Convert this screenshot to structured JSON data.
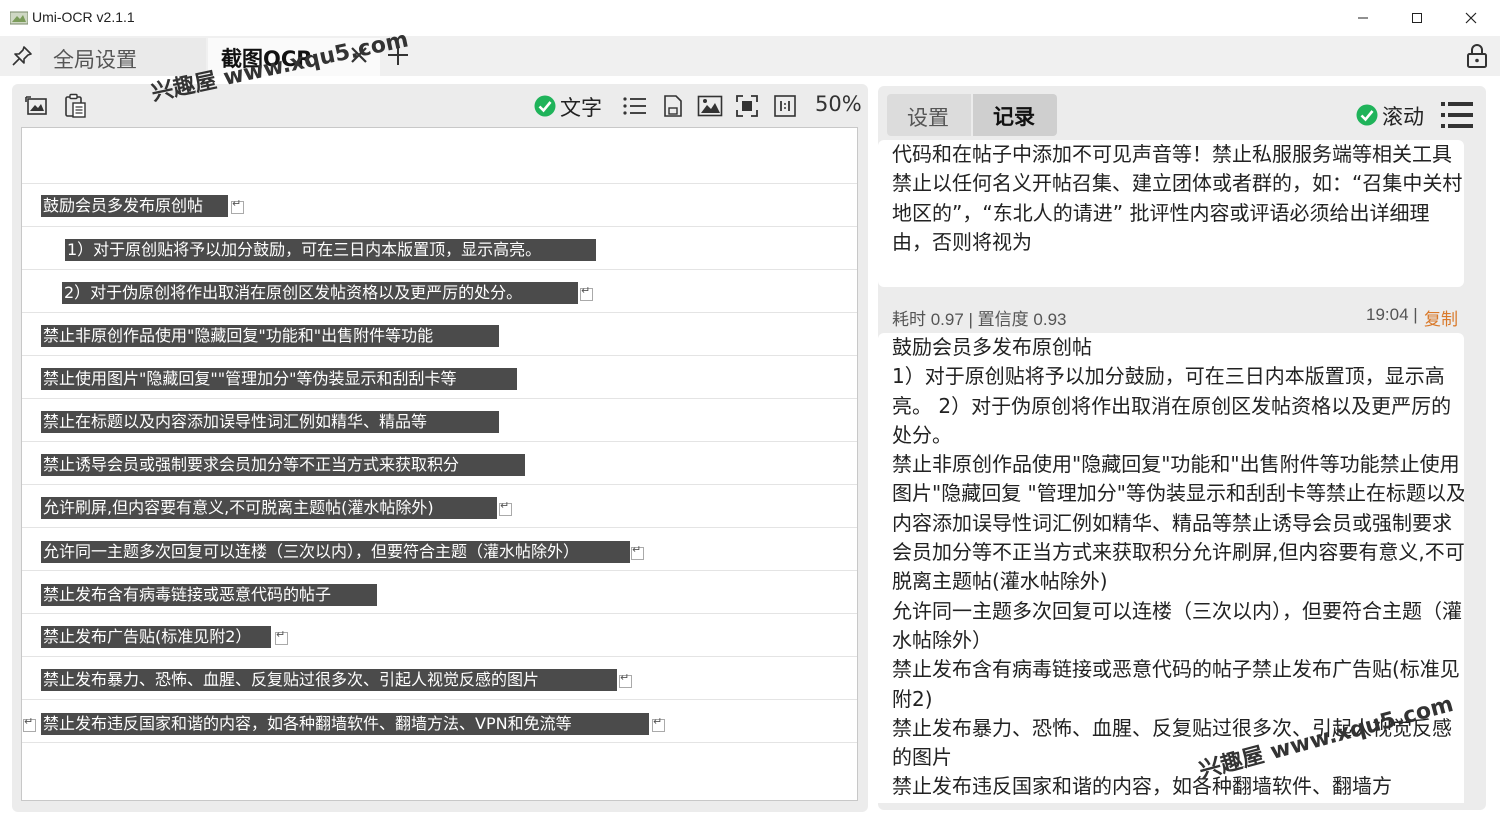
{
  "window": {
    "title": "Umi-OCR v2.1.1"
  },
  "tabs": {
    "global_settings": "全局设置",
    "screenshot_ocr": "截图OCR"
  },
  "left_toolbar": {
    "text_toggle_label": "文字",
    "zoom": "50%"
  },
  "ocr_lines": [
    "鼓励会员多发布原创帖",
    "1）对于原创贴将予以加分鼓励，可在三日内本版置顶，显示高亮。",
    "2）对于伪原创将作出取消在原创区发帖资格以及更严厉的处分。",
    "禁止非原创作品使用\"隐藏回复\"功能和\"出售附件等功能",
    "禁止使用图片\"隐藏回复\"\"管理加分\"等伪装显示和刮刮卡等",
    "禁止在标题以及内容添加误导性词汇例如精华、精品等",
    "禁止诱导会员或强制要求会员加分等不正当方式来获取积分",
    "允许刷屏,但内容要有意义,不可脱离主题帖(灌水帖除外)",
    "允许同一主题多次回复可以连楼（三次以内），但要符合主题（灌水帖除外）",
    "禁止发布含有病毒链接或恶意代码的帖子",
    "禁止发布广告贴(标准见附2）",
    "禁止发布暴力、恐怖、血腥、反复贴过很多次、引起人视觉反感的图片",
    "禁止发布违反国家和谐的内容，如各种翻墙软件、翻墙方法、VPN和免流等"
  ],
  "right_panel": {
    "tab_settings": "设置",
    "tab_record": "记录",
    "scroll_label": "滚动",
    "previous_record_text": "代码和在帖子中添加不可见声音等！禁止私服服务端等相关工具\n禁止以任何名义开帖召集、建立团体或者群的，如：“召集中关村地区的”，“东北人的请进” 批评性内容或评语必须给出详细理由，否则将视为",
    "record": {
      "meta": "耗时 0.97 | 置信度 0.93",
      "time": "19:04 |",
      "copy": "复制",
      "text": "鼓励会员多发布原创帖\n1）对于原创贴将予以加分鼓励，可在三日内本版置顶，显示高亮。 2）对于伪原创将作出取消在原创区发帖资格以及更严厉的处分。\n禁止非原创作品使用\"隐藏回复\"功能和\"出售附件等功能禁止使用图片\"隐藏回复 \"管理加分\"等伪装显示和刮刮卡等禁止在标题以及内容添加误导性词汇例如精华、精品等禁止诱导会员或强制要求会员加分等不正当方式来获取积分允许刷屏,但内容要有意义,不可脱离主题帖(灌水帖除外)\n允许同一主题多次回复可以连楼（三次以内），但要符合主题（灌水帖除外）\n禁止发布含有病毒链接或恶意代码的帖子禁止发布广告贴(标准见附2)\n禁止发布暴力、恐怖、血腥、反复贴过很多次、引起人视觉反感的图片\n禁止发布违反国家和谐的内容，如各种翻墙软件、翻墙方"
    }
  },
  "watermarks": {
    "top": "兴趣屋 www.xqu5.com",
    "bottom": "兴趣屋 www.xqu5.com"
  },
  "colors": {
    "check_green": "#1fb35a",
    "copy_orange": "#d9792a",
    "ocr_highlight": "#4b4b4b"
  }
}
